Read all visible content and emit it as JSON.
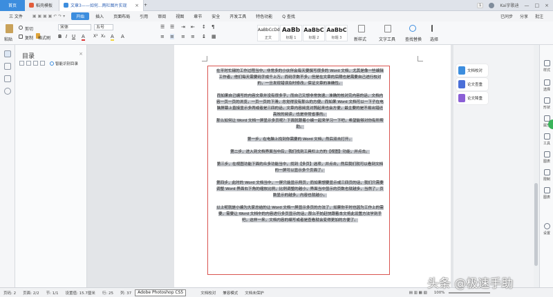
{
  "tabs": [
    {
      "label": "首页"
    },
    {
      "label": "稻壳模板"
    },
    {
      "label": "文章3——如何...两栏图片实现"
    }
  ],
  "window": {
    "badge": "1",
    "user": "Kai宇歌迪"
  },
  "menu": {
    "items": [
      "三 文件",
      "开始",
      "插入",
      "页面布局",
      "引用",
      "审阅",
      "视图",
      "章节",
      "安全",
      "开发工具",
      "特色功能",
      "Q 查找"
    ],
    "right": [
      "已同步",
      "分享",
      "批注"
    ]
  },
  "ribbon": {
    "paste": "粘贴",
    "cut": "剪切",
    "copy": "复制",
    "format_painter": "格式刷",
    "font": "宋体",
    "font_size": "五号",
    "styles": [
      {
        "preview": "AaBbCcDd",
        "label": "正文"
      },
      {
        "preview": "AaBb",
        "label": "标题 1"
      },
      {
        "preview": "AaBbC",
        "label": "标题 2"
      },
      {
        "preview": "AaBbC",
        "label": "标题 3"
      }
    ],
    "new_style": "新样式",
    "text_tools": "文字工具",
    "find_replace": "查找替换",
    "select": "选择"
  },
  "toc": {
    "title": "目录",
    "smart": "智能识别目录"
  },
  "document": {
    "paragraphs": [
      "在平时忙碌的工作过程当中，非常多的小伙伴会每天要撰写很多的 Word 文档，尤其是像一些编辑工作者，他们每天需要码字成千上万。而码字数不多，但是在文章的后期也是需要自己进行校对的，一旦发现错误及时修改，保证文章的准确性。",
      "而如果自己编写的内容文章并没有很多字，而自己又想非常快速、准确的核对完内容的话，文档内容一页一页的浏览，一页一页的下滑，总觉得没有那么的方便。而如果 Word 文档可以一下子在电脑屏幕上直接显示多两或者是三四的话，文章内容阅览对照起来也会方便，最主要的是不易出错还高效的阅读，也是非常省事的。",
      "那么如何让 Word 文档一屏显示多页呢？下面就跟着小编一起来学习一下吧，希望能够对你有所帮助。",
      "第一步，在电脑上找到你需要的 Word 文档，然后双击打开。",
      "第二步，进入到文档界面当中后，我们找到工具栏上方的【视图】功能，并点击。",
      "第三步，在视图功能下面的众多功能当中，找到【多页】选项，并点击，然后我们就可以看到文档的一屏可以显示多个页面了。",
      "第四步，此时的 Word 文档当中，一屏只能显示两页，而如果想要显示或三四页的话，我们只需要调整 Word 界面右下角的缩放比例，比例调整的越小，界面当中显示的页数也就越多，当然了，页数显示的越多，内容也就越小。",
      "以上呢就是小编为大家总结的让 Word 文档一屏显示多页的方法了，如果你平时也因为工作上的需要，需要让 Word 文档中的内容进行多页显示的话，那么不妨赶快跟着本文将此设置方法学到手吧，这样一来，文档内容的编写或者是查看就会变得更加的方便了。"
    ]
  },
  "assist": {
    "items": [
      "文档校对",
      "论文查重",
      "论文降重"
    ]
  },
  "rightbar": {
    "items": [
      "样式",
      "选择",
      "形状",
      "属性",
      "工具",
      "图表",
      "限制",
      "图表",
      "设置"
    ]
  },
  "status": {
    "page": "页码: 2",
    "pages": "页面: 2/2",
    "section": "节: 1/1",
    "setting": "设置值: 15.7厘米",
    "row": "行: 25",
    "col": "列: 37",
    "tooltip": "Adobe Photoshop CS5",
    "proof": "文档校对",
    "compat": "兼容模式",
    "protect": "文档未保护",
    "zoom": "100%"
  },
  "watermark": "头条 @极速手助",
  "colors": {
    "accent": "#3c8dde",
    "selection": "#c6c9ce",
    "redbox": "#d9534f"
  }
}
